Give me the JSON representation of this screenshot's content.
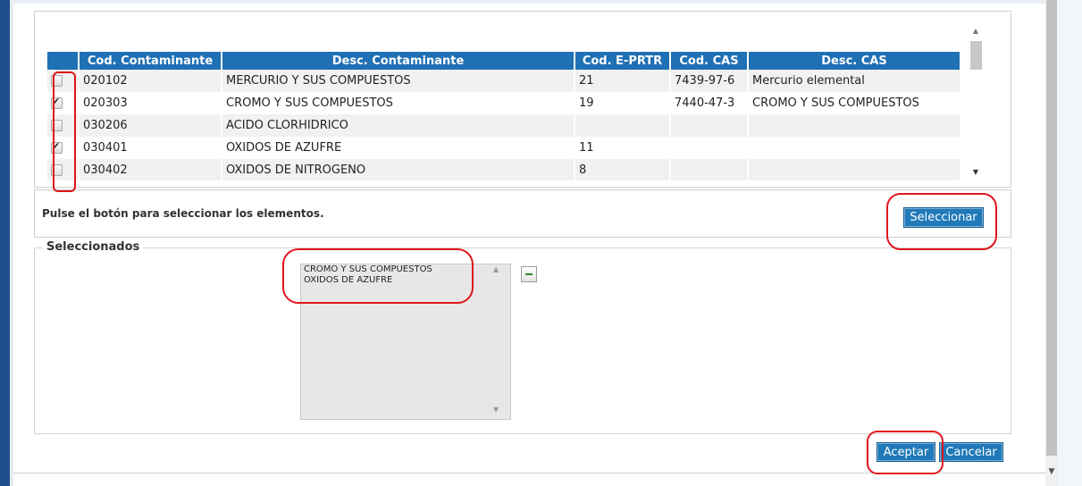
{
  "table": {
    "headers": [
      "",
      "Cod. Contaminante",
      "Desc. Contaminante",
      "Cod. E-PRTR",
      "Cod. CAS",
      "Desc. CAS"
    ],
    "rows": [
      {
        "checked": false,
        "cod": "020102",
        "desc": "MERCURIO Y SUS COMPUESTOS",
        "eprtr": "21",
        "cas": "7439-97-6",
        "desc_cas": "Mercurio elemental"
      },
      {
        "checked": true,
        "cod": "020303",
        "desc": "CROMO Y SUS COMPUESTOS",
        "eprtr": "19",
        "cas": "7440-47-3",
        "desc_cas": "CROMO Y SUS COMPUESTOS"
      },
      {
        "checked": false,
        "cod": "030206",
        "desc": "ACIDO CLORHIDRICO",
        "eprtr": "",
        "cas": "",
        "desc_cas": ""
      },
      {
        "checked": true,
        "cod": "030401",
        "desc": "OXIDOS DE AZUFRE",
        "eprtr": "11",
        "cas": "",
        "desc_cas": ""
      },
      {
        "checked": false,
        "cod": "030402",
        "desc": "OXIDOS DE NITROGENO",
        "eprtr": "8",
        "cas": "",
        "desc_cas": ""
      }
    ]
  },
  "hint": "Pulse el botón para seleccionar los elementos.",
  "select_button": "Seleccionar",
  "selected": {
    "legend": "Seleccionados",
    "items": [
      "CROMO Y SUS COMPUESTOS",
      "OXIDOS DE AZUFRE"
    ]
  },
  "footer": {
    "accept": "Aceptar",
    "cancel": "Cancelar"
  },
  "colors": {
    "header_bg": "#1f70b4",
    "button_bg": "#2079b8",
    "annotation": "#e0151c"
  }
}
